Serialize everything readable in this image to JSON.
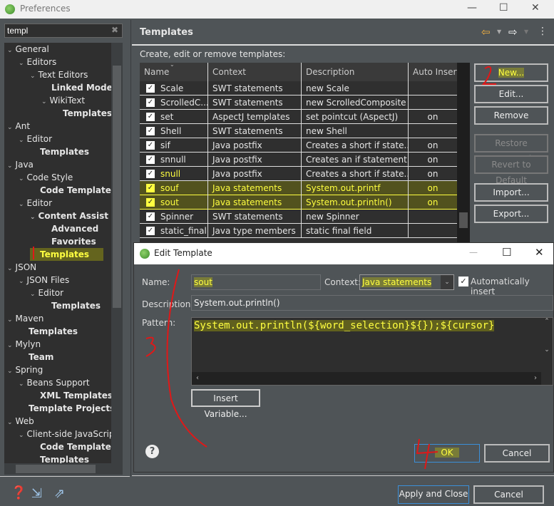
{
  "window": {
    "title": "Preferences"
  },
  "filter": {
    "value": "templ"
  },
  "tree": [
    {
      "label": "General",
      "level": 0,
      "chev": true,
      "bold": false
    },
    {
      "label": "Editors",
      "level": 1,
      "chev": true,
      "bold": false
    },
    {
      "label": "Text Editors",
      "level": 2,
      "chev": true,
      "bold": false
    },
    {
      "label": "Linked Mode",
      "level": 3,
      "chev": false,
      "bold": true
    },
    {
      "label": "WikiText",
      "level": 3,
      "chev": true,
      "bold": false
    },
    {
      "label": "Templates",
      "level": 4,
      "chev": false,
      "bold": true
    },
    {
      "label": "Ant",
      "level": 0,
      "chev": true,
      "bold": false
    },
    {
      "label": "Editor",
      "level": 1,
      "chev": true,
      "bold": false
    },
    {
      "label": "Templates",
      "level": 2,
      "chev": false,
      "bold": true
    },
    {
      "label": "Java",
      "level": 0,
      "chev": true,
      "bold": false
    },
    {
      "label": "Code Style",
      "level": 1,
      "chev": true,
      "bold": false
    },
    {
      "label": "Code Templates",
      "level": 2,
      "chev": false,
      "bold": true
    },
    {
      "label": "Editor",
      "level": 1,
      "chev": true,
      "bold": false
    },
    {
      "label": "Content Assist",
      "level": 2,
      "chev": true,
      "bold": true
    },
    {
      "label": "Advanced",
      "level": 3,
      "chev": false,
      "bold": true
    },
    {
      "label": "Favorites",
      "level": 3,
      "chev": false,
      "bold": true
    },
    {
      "label": "Templates",
      "level": 2,
      "chev": false,
      "bold": true,
      "selected": true
    },
    {
      "label": "JSON",
      "level": 0,
      "chev": true,
      "bold": false
    },
    {
      "label": "JSON Files",
      "level": 1,
      "chev": true,
      "bold": false
    },
    {
      "label": "Editor",
      "level": 2,
      "chev": true,
      "bold": false
    },
    {
      "label": "Templates",
      "level": 3,
      "chev": false,
      "bold": true
    },
    {
      "label": "Maven",
      "level": 0,
      "chev": true,
      "bold": false
    },
    {
      "label": "Templates",
      "level": 1,
      "chev": false,
      "bold": true
    },
    {
      "label": "Mylyn",
      "level": 0,
      "chev": true,
      "bold": false
    },
    {
      "label": "Team",
      "level": 1,
      "chev": false,
      "bold": true
    },
    {
      "label": "Spring",
      "level": 0,
      "chev": true,
      "bold": false
    },
    {
      "label": "Beans Support",
      "level": 1,
      "chev": true,
      "bold": false
    },
    {
      "label": "XML Templates",
      "level": 2,
      "chev": false,
      "bold": true
    },
    {
      "label": "Template Projects",
      "level": 1,
      "chev": false,
      "bold": true
    },
    {
      "label": "Web",
      "level": 0,
      "chev": true,
      "bold": false
    },
    {
      "label": "Client-side JavaScript",
      "level": 1,
      "chev": true,
      "bold": false
    },
    {
      "label": "Code Templates",
      "level": 2,
      "chev": false,
      "bold": true
    },
    {
      "label": "Templates",
      "level": 2,
      "chev": false,
      "bold": true
    }
  ],
  "page": {
    "title": "Templates",
    "description": "Create, edit or remove templates:"
  },
  "table": {
    "columns": [
      "Name",
      "Context",
      "Description",
      "Auto Insert"
    ],
    "rows": [
      {
        "name": "Scale",
        "context": "SWT statements",
        "description": "new Scale",
        "auto": ""
      },
      {
        "name": "ScrolledC...",
        "context": "SWT statements",
        "description": "new ScrolledComposite",
        "auto": ""
      },
      {
        "name": "set",
        "context": "AspectJ templates",
        "description": "set pointcut (AspectJ)",
        "auto": "on"
      },
      {
        "name": "Shell",
        "context": "SWT statements",
        "description": "new Shell",
        "auto": ""
      },
      {
        "name": "sif",
        "context": "Java postfix",
        "description": "Creates a short if state...",
        "auto": "on"
      },
      {
        "name": "snnull",
        "context": "Java postfix",
        "description": "Creates an if statement...",
        "auto": "on"
      },
      {
        "name": "snull",
        "context": "Java postfix",
        "description": "Creates a short if state...",
        "auto": "on"
      },
      {
        "name": "souf",
        "context": "Java statements",
        "description": "System.out.printf",
        "auto": "on",
        "highlight": true
      },
      {
        "name": "sout",
        "context": "Java statements",
        "description": "System.out.println()",
        "auto": "on",
        "highlight": true
      },
      {
        "name": "Spinner",
        "context": "SWT statements",
        "description": "new Spinner",
        "auto": ""
      },
      {
        "name": "static_final",
        "context": "Java type members",
        "description": "static final field",
        "auto": ""
      }
    ]
  },
  "buttons": {
    "new": "New...",
    "edit": "Edit...",
    "remove": "Remove",
    "restore": "Restore Removed",
    "revert": "Revert to Default",
    "import": "Import...",
    "export": "Export..."
  },
  "dialog": {
    "title": "Edit Template",
    "name_label": "Name:",
    "name_value": "sout",
    "context_label": "Context:",
    "context_value": "Java statements",
    "auto_insert_label": "Automatically insert",
    "auto_insert_checked": true,
    "description_label": "Description:",
    "description_value": "System.out.println()",
    "pattern_label": "Pattern:",
    "pattern_value": "System.out.println(${word_selection}${});${cursor}",
    "insert_variable": "Insert Variable...",
    "ok": "OK",
    "cancel": "Cancel"
  },
  "footer": {
    "apply_close": "Apply and Close",
    "cancel": "Cancel"
  },
  "annotations": [
    "1",
    "2",
    "3",
    "4"
  ],
  "colors": {
    "highlight": "#ffff40",
    "annotation": "#ff1a1a",
    "focus": "#3b8fd9"
  }
}
